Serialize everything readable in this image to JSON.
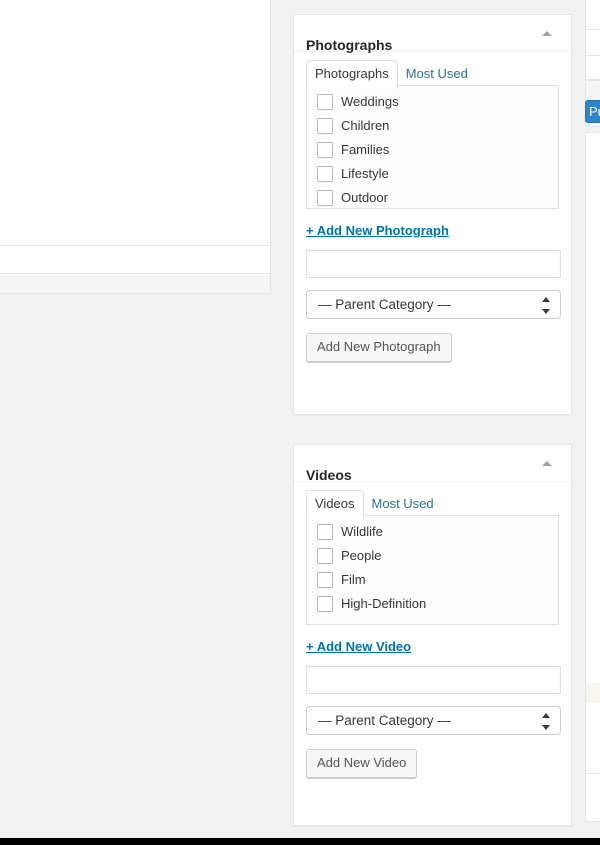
{
  "window": {
    "background_color": "#f1f1f1"
  },
  "left_column": {
    "name": "content-editor"
  },
  "right_sliver": {
    "publish_label": "Publish"
  },
  "boxes": [
    {
      "id": "photographs",
      "title": "Photographs",
      "toggle_icon": "chevron-up-icon",
      "tabs": [
        {
          "label": "Photographs",
          "active": true
        },
        {
          "label": "Most Used",
          "active": false
        }
      ],
      "checklist": [
        {
          "label": "Weddings",
          "checked": false
        },
        {
          "label": "Children",
          "checked": false
        },
        {
          "label": "Families",
          "checked": false
        },
        {
          "label": "Lifestyle",
          "checked": false
        },
        {
          "label": "Outdoor",
          "checked": false
        }
      ],
      "add_new_link": "+ Add New Photograph",
      "new_input": {
        "value": "",
        "placeholder": ""
      },
      "parent_select": {
        "selected": "— Parent Category —"
      },
      "submit_label": "Add New Photograph"
    },
    {
      "id": "videos",
      "title": "Videos",
      "toggle_icon": "chevron-up-icon",
      "tabs": [
        {
          "label": "Videos",
          "active": true
        },
        {
          "label": "Most Used",
          "active": false
        }
      ],
      "checklist": [
        {
          "label": "Wildlife",
          "checked": false
        },
        {
          "label": "People",
          "checked": false
        },
        {
          "label": "Film",
          "checked": false
        },
        {
          "label": "High-Definition",
          "checked": false
        }
      ],
      "add_new_link": "+ Add New Video",
      "new_input": {
        "value": "",
        "placeholder": ""
      },
      "parent_select": {
        "selected": "— Parent Category —"
      },
      "submit_label": "Add New Video"
    }
  ],
  "colors": {
    "link": "#0073aa",
    "tab_link": "#2b7199",
    "publish_button": "#2e84c8",
    "page_background": "#f1f1f1",
    "panel_background": "#ffffff",
    "panel_border": "#e5e5e5"
  }
}
